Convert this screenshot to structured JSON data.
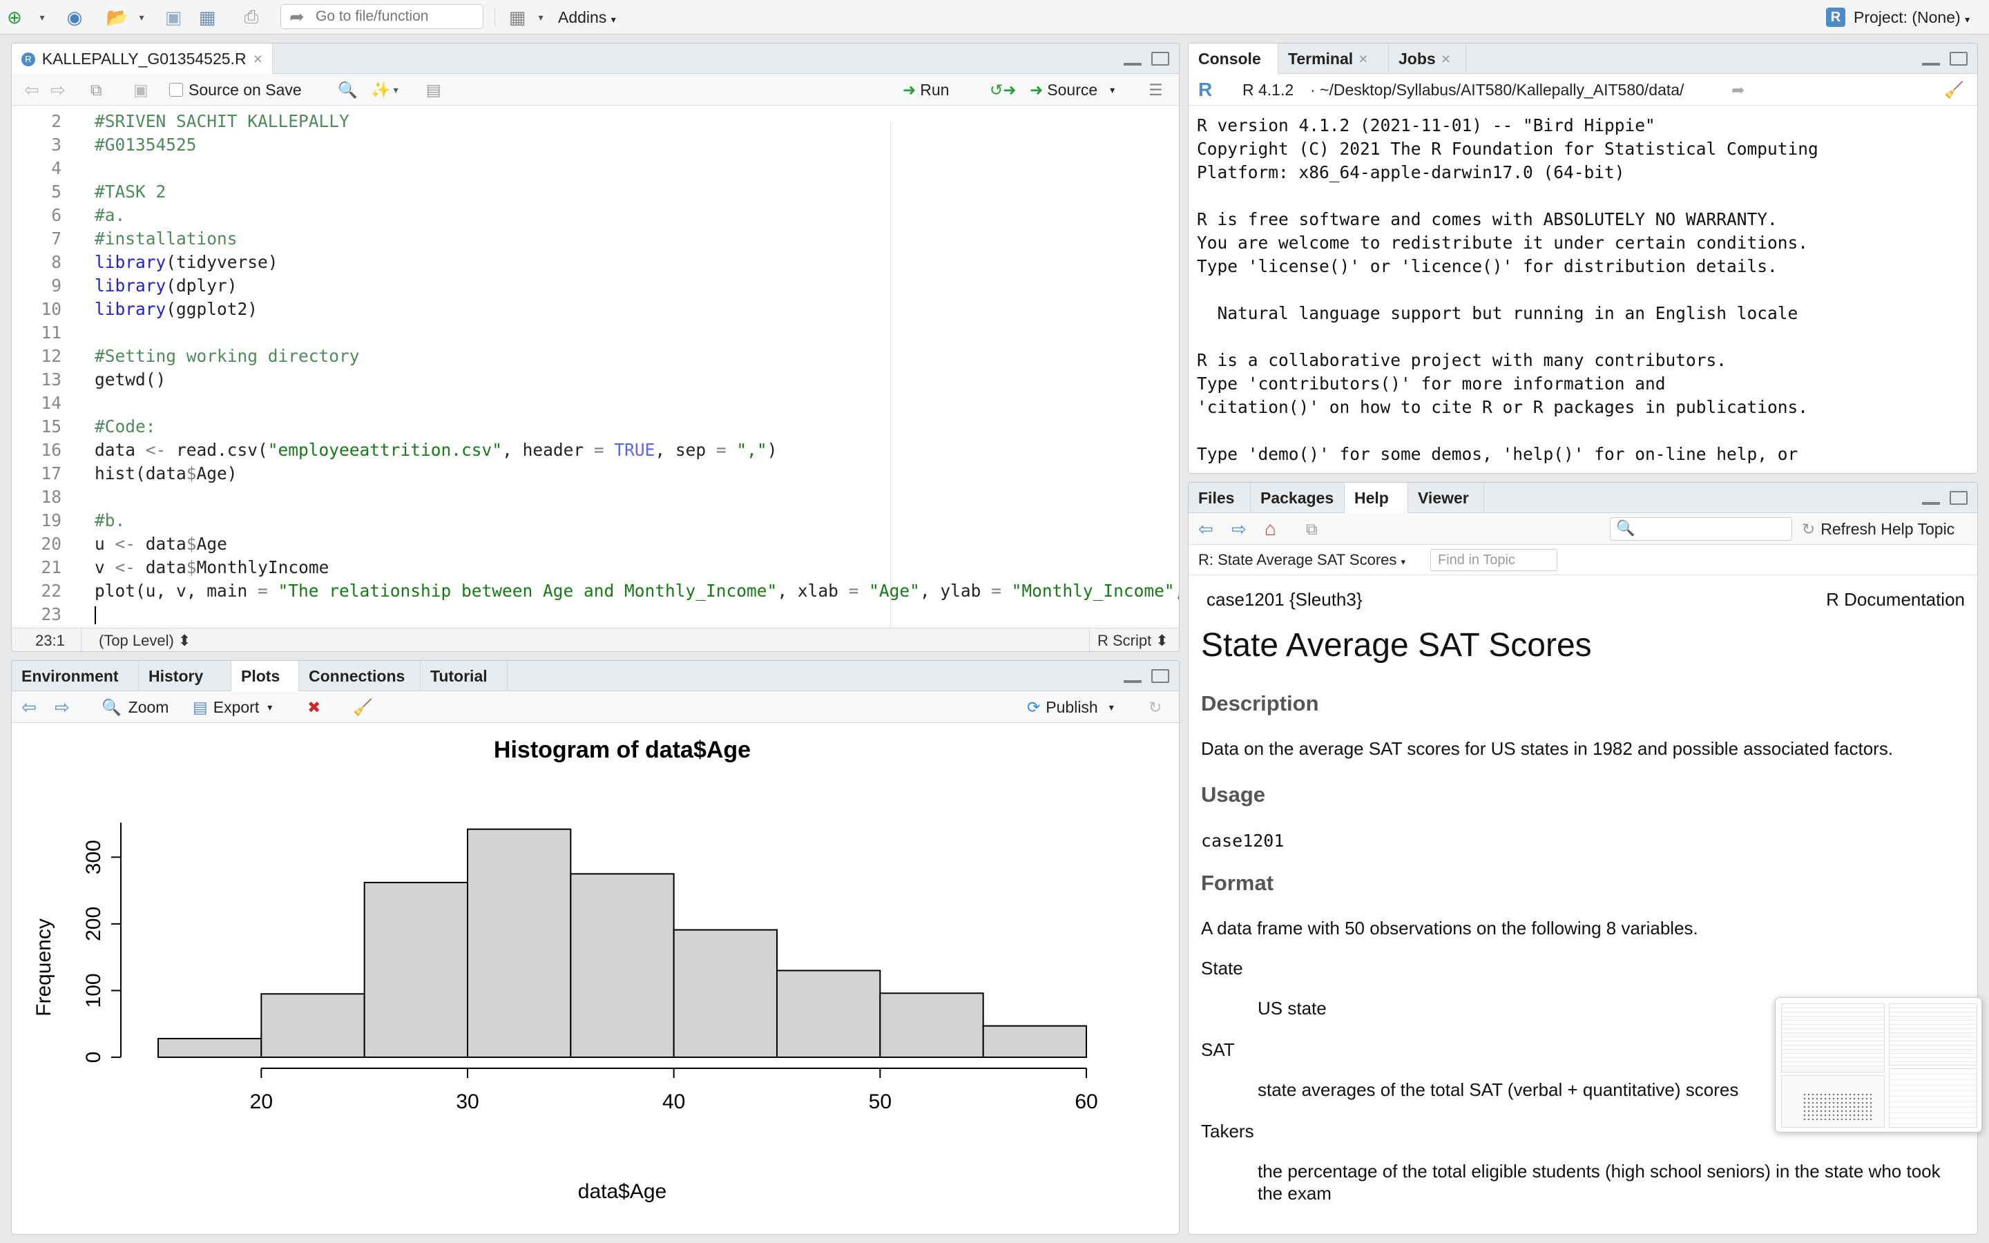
{
  "toolbar": {
    "goto_placeholder": "Go to file/function",
    "addins_label": "Addins",
    "project_label": "Project: (None)"
  },
  "editor": {
    "tab_title": "KALLEPALLY_G01354525.R",
    "source_on_save": "Source on Save",
    "run_label": "Run",
    "source_label": "Source",
    "lines": [
      {
        "n": "2",
        "html": "<span class='cm'>#SRIVEN SACHIT KALLEPALLY</span>"
      },
      {
        "n": "3",
        "html": "<span class='cm'>#G01354525</span>"
      },
      {
        "n": "4",
        "html": ""
      },
      {
        "n": "5",
        "html": "<span class='cm'>#TASK 2</span>"
      },
      {
        "n": "6",
        "html": "<span class='cm'>#a.</span>"
      },
      {
        "n": "7",
        "html": "<span class='cm'>#installations</span>"
      },
      {
        "n": "8",
        "html": "<span class='kw'>library</span>(tidyverse)"
      },
      {
        "n": "9",
        "html": "<span class='kw'>library</span>(dplyr)"
      },
      {
        "n": "10",
        "html": "<span class='kw'>library</span>(ggplot2)"
      },
      {
        "n": "11",
        "html": ""
      },
      {
        "n": "12",
        "html": "<span class='cm'>#Setting working directory</span>"
      },
      {
        "n": "13",
        "html": "getwd()"
      },
      {
        "n": "14",
        "html": ""
      },
      {
        "n": "15",
        "html": "<span class='cm'>#Code:</span>"
      },
      {
        "n": "16",
        "html": "data <span class='op'>&lt;-</span> read.csv(<span class='st'>\"employeeattrition.csv\"</span>, header <span class='op'>=</span> <span class='tr'>TRUE</span>, sep <span class='op'>=</span> <span class='st'>\",\"</span>)"
      },
      {
        "n": "17",
        "html": "hist(data<span class='op'>$</span>Age)"
      },
      {
        "n": "18",
        "html": ""
      },
      {
        "n": "19",
        "html": "<span class='cm'>#b.</span>"
      },
      {
        "n": "20",
        "html": "u <span class='op'>&lt;-</span> data<span class='op'>$</span>Age"
      },
      {
        "n": "21",
        "html": "v <span class='op'>&lt;-</span> data<span class='op'>$</span>MonthlyIncome"
      },
      {
        "n": "22",
        "html": "plot(u, v, main <span class='op'>=</span> <span class='st'>\"The relationship between Age and Monthly_Income\"</span>, xlab <span class='op'>=</span> <span class='st'>\"Age\"</span>, ylab <span class='op'>=</span> <span class='st'>\"Monthly_Income\"</span>, pc"
      },
      {
        "n": "23",
        "html": ""
      }
    ],
    "status_pos": "23:1",
    "status_scope": "(Top Level) ⬍",
    "status_type": "R Script ⬍"
  },
  "console": {
    "tabs": [
      "Console",
      "Terminal",
      "Jobs"
    ],
    "version": "R 4.1.2",
    "path": "· ~/Desktop/Syllabus/AIT580/Kallepally_AIT580/data/",
    "lines": [
      "R version 4.1.2 (2021-11-01) -- \"Bird Hippie\"",
      "Copyright (C) 2021 The R Foundation for Statistical Computing",
      "Platform: x86_64-apple-darwin17.0 (64-bit)",
      "",
      "R is free software and comes with ABSOLUTELY NO WARRANTY.",
      "You are welcome to redistribute it under certain conditions.",
      "Type 'license()' or 'licence()' for distribution details.",
      "",
      "  Natural language support but running in an English locale",
      "",
      "R is a collaborative project with many contributors.",
      "Type 'contributors()' for more information and",
      "'citation()' on how to cite R or R packages in publications.",
      "",
      "Type 'demo()' for some demos, 'help()' for on-line help, or"
    ]
  },
  "env": {
    "tabs": [
      "Environment",
      "History",
      "Plots",
      "Connections",
      "Tutorial"
    ],
    "zoom_label": "Zoom",
    "export_label": "Export",
    "publish_label": "Publish"
  },
  "help": {
    "tabs": [
      "Files",
      "Packages",
      "Help",
      "Viewer"
    ],
    "refresh_label": "Refresh Help Topic",
    "topic_select": "R: State Average SAT Scores",
    "find_placeholder": "Find in Topic",
    "doc_id": "case1201 {Sleuth3}",
    "doc_type": "R Documentation",
    "title": "State Average SAT Scores",
    "desc_h": "Description",
    "desc": "Data on the average SAT scores for US states in 1982 and possible associated factors.",
    "usage_h": "Usage",
    "usage": "case1201",
    "format_h": "Format",
    "format": "A data frame with 50 observations on the following 8 variables.",
    "var1": "State",
    "var1_desc": "US state",
    "var2": "SAT",
    "var2_desc": "state averages of the total SAT (verbal + quantitative) scores",
    "var3": "Takers",
    "var3_desc_1": "the percentage of the total eligible students (high school seniors) in the state who took",
    "var3_desc_2": "the exam"
  },
  "chart_data": {
    "type": "bar",
    "title": "Histogram of data$Age",
    "xlabel": "data$Age",
    "ylabel": "Frequency",
    "bins": [
      [
        15,
        20
      ],
      [
        20,
        25
      ],
      [
        25,
        30
      ],
      [
        30,
        35
      ],
      [
        35,
        40
      ],
      [
        40,
        45
      ],
      [
        45,
        50
      ],
      [
        50,
        55
      ],
      [
        55,
        60
      ]
    ],
    "values": [
      28,
      95,
      262,
      342,
      275,
      191,
      130,
      96,
      47
    ],
    "xticks": [
      20,
      30,
      40,
      50,
      60
    ],
    "yticks": [
      0,
      100,
      200,
      300
    ],
    "xlim": [
      15,
      60
    ],
    "ylim": [
      0,
      350
    ],
    "bar_color": "#d3d3d3"
  }
}
